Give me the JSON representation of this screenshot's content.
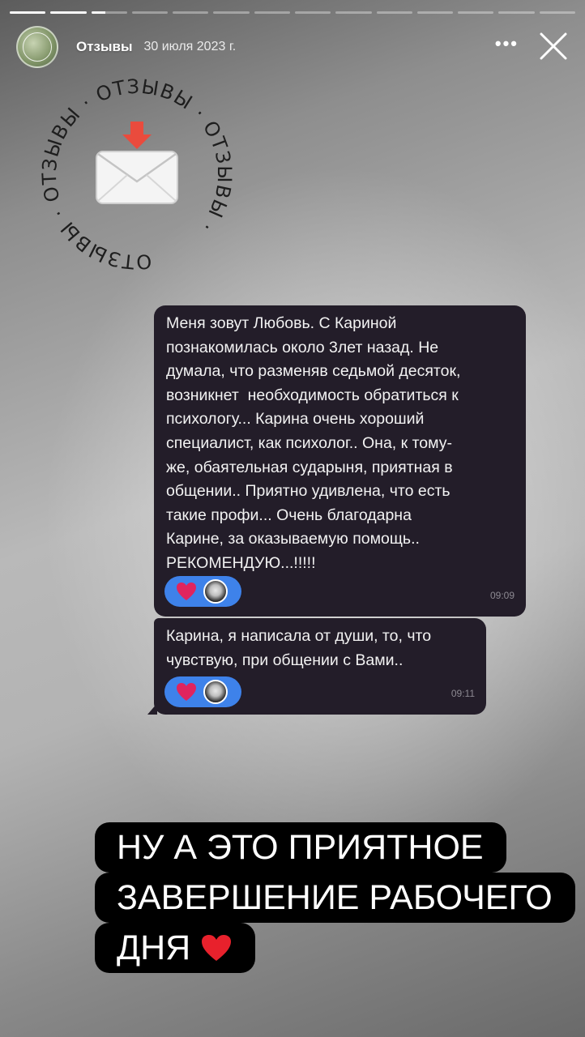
{
  "story": {
    "segments": [
      1,
      1,
      0.4,
      0,
      0,
      0,
      0,
      0,
      0,
      0,
      0,
      0,
      0,
      0
    ],
    "account": "Отзывы",
    "date": "30 июля 2023 г.",
    "more_icon": "ellipsis-icon",
    "close_icon": "close-icon"
  },
  "sticker": {
    "ring_text": "ОТЗЫВЫ · ОТЗЫВЫ · ОТЗЫВЫ · ОТЗЫВЫ · ",
    "icon": "envelope-with-down-arrow-icon"
  },
  "messages": [
    {
      "lines": [
        "Меня зовут Любовь. С Кариной",
        "познакомилась около 3лет назад. Не",
        "думала, что разменяв седьмой десяток,",
        "возникнет  необходимость обратиться к",
        "психологу... Карина очень хороший",
        "специалист, как психолог.. Она, к тому-",
        "же, обаятельная сударыня, приятная в",
        "общении.. Приятно удивлена, что есть",
        "такие профи... Очень благодарна",
        "Карине, за оказываемую помощь..",
        "РЕКОМЕНДУЮ...!!!!!"
      ],
      "reaction": "heart-icon",
      "time": "09:09"
    },
    {
      "lines": [
        "Карина, я написала от души, то, что",
        "чувствую, при общении с Вами.."
      ],
      "reaction": "heart-icon",
      "time": "09:11"
    }
  ],
  "caption": {
    "line1": "НУ А ЭТО ПРИЯТНОЕ",
    "line2": "ЗАВЕРШЕНИЕ РАБОЧЕГО",
    "line3": "ДНЯ",
    "emoji": "red-heart-icon"
  },
  "colors": {
    "bubble": "#231d29",
    "reaction_pill": "#3e82ea",
    "heart": "#e0245e",
    "caption_bg": "#000000"
  }
}
